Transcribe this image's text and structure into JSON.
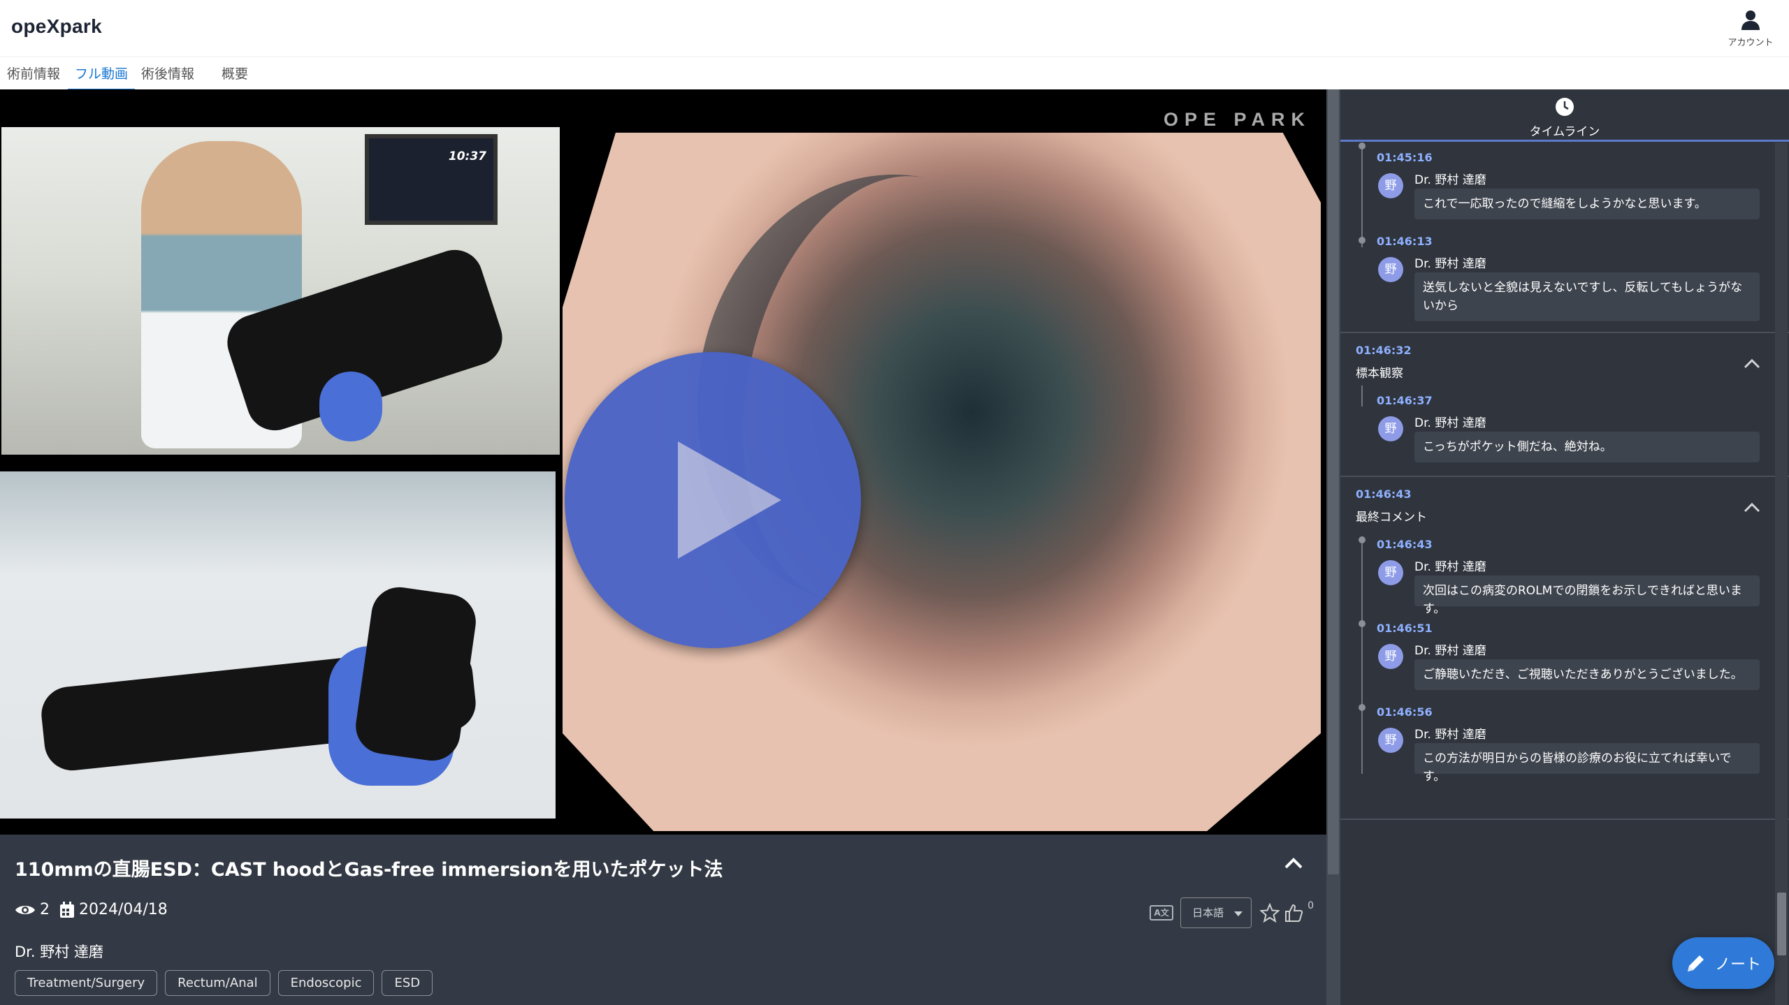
{
  "app": {
    "logo": "opeXpark"
  },
  "header": {
    "account_label": "アカウント"
  },
  "tabs": [
    {
      "label": "術前情報"
    },
    {
      "label": "フル動画"
    },
    {
      "label": "術後情報"
    },
    {
      "label": "概要"
    }
  ],
  "player": {
    "watermark": "OPE  PARK",
    "camera_overlay_time": "10:37"
  },
  "video": {
    "title": "110mmの直腸ESD：CAST hoodとGas-free immersionを用いたポケット法",
    "views": "2",
    "date": "2024/04/18",
    "author": "Dr. 野村 達磨",
    "tags": [
      "Treatment/Surgery",
      "Rectum/Anal",
      "Endoscopic",
      "ESD"
    ],
    "language": "日本語",
    "translate_icon_text": "A文",
    "like_count": "0"
  },
  "timeline": {
    "header_label": "タイムライン",
    "groups": [
      {
        "time": "",
        "title": "",
        "entries": [
          {
            "time": "01:45:16",
            "avatar": "野",
            "name": "Dr. 野村 達磨",
            "text": "これで一応取ったので縫縮をしようかなと思います。"
          },
          {
            "time": "01:46:13",
            "avatar": "野",
            "name": "Dr. 野村 達磨",
            "text": "送気しないと全貌は見えないですし、反転してもしょうがないから"
          }
        ]
      },
      {
        "time": "01:46:32",
        "title": "標本観察",
        "entries": [
          {
            "time": "01:46:37",
            "avatar": "野",
            "name": "Dr. 野村 達磨",
            "text": "こっちがポケット側だね、絶対ね。"
          }
        ]
      },
      {
        "time": "01:46:43",
        "title": "最終コメント",
        "entries": [
          {
            "time": "01:46:43",
            "avatar": "野",
            "name": "Dr. 野村 達磨",
            "text": "次回はこの病変のROLMでの閉鎖をお示しできればと思います。"
          },
          {
            "time": "01:46:51",
            "avatar": "野",
            "name": "Dr. 野村 達磨",
            "text": "ご静聴いただき、ご視聴いただきありがとうございました。"
          },
          {
            "time": "01:46:56",
            "avatar": "野",
            "name": "Dr. 野村 達磨",
            "text": "この方法が明日からの皆様の診療のお役に立てれば幸いです。"
          }
        ]
      }
    ]
  },
  "note_button": {
    "label": "ノート"
  },
  "colors": {
    "accent": "#1976d2",
    "timeline_time": "#8fb1ff",
    "panel_bg": "#343a45",
    "sidebar_bg": "#2f343d",
    "fab": "#2f7ad8",
    "avatar": "#8e9ce8"
  },
  "icons": [
    "user-icon",
    "eye-icon",
    "calendar-icon",
    "translate-icon",
    "star-icon",
    "thumbs-up-icon",
    "clock-icon",
    "chevron-up-icon",
    "pencil-icon",
    "play-icon"
  ]
}
